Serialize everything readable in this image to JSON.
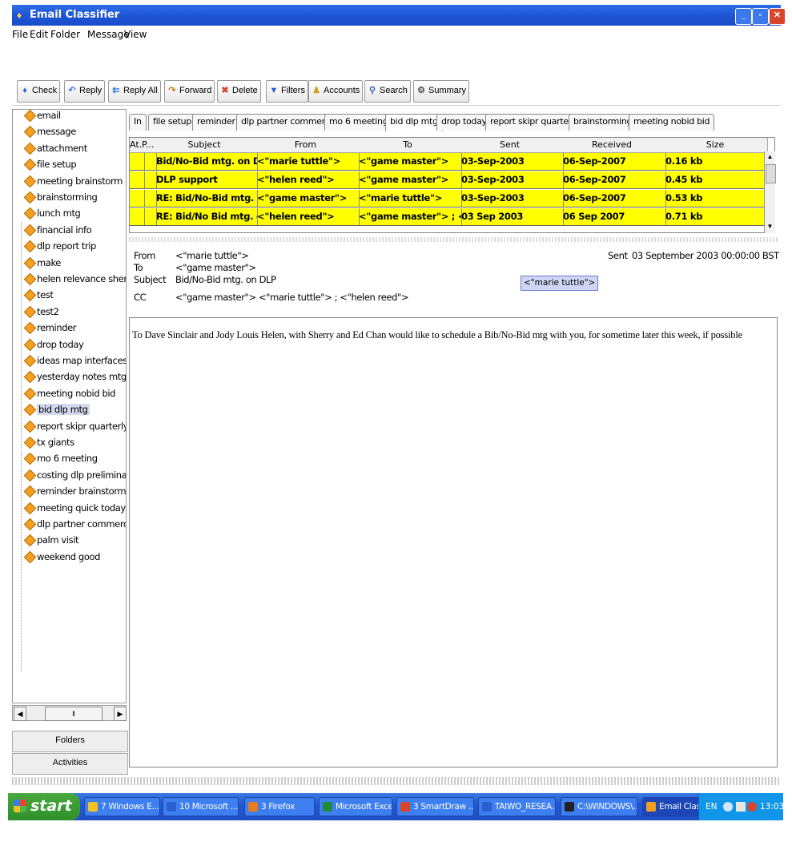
{
  "window": {
    "title": "Email Classifier"
  },
  "menu": [
    "File",
    "Edit",
    "Folder",
    "Message",
    "View"
  ],
  "toolbar": [
    {
      "label": "Check",
      "icon": "check-mail-icon",
      "color": "#2a6dd8"
    },
    {
      "label": "Reply",
      "icon": "reply-icon",
      "color": "#3a7ae8"
    },
    {
      "label": "Reply All",
      "icon": "reply-all-icon",
      "color": "#3a7ae8"
    },
    {
      "label": "Forward",
      "icon": "forward-icon",
      "color": "#d07a18"
    },
    {
      "label": "Delete",
      "icon": "delete-icon",
      "color": "#d8452b"
    },
    {
      "label": "Filters",
      "icon": "filter-icon",
      "color": "#2a5fd0"
    },
    {
      "label": "Accounts",
      "icon": "accounts-icon",
      "color": "#d0a020"
    },
    {
      "label": "Search",
      "icon": "search-icon",
      "color": "#2a5fd0"
    },
    {
      "label": "Summary",
      "icon": "summary-icon",
      "color": "#555555"
    }
  ],
  "folders": {
    "items": [
      "email",
      "message",
      "attachment",
      "file setup",
      "meeting brainstorm",
      "brainstorming",
      "lunch mtg",
      "financial info",
      "dlp report trip",
      "make",
      "helen relevance sherry",
      "test",
      "test2",
      "reminder",
      "drop today",
      "ideas map interfaces",
      "yesterday notes mtg",
      "meeting nobid bid",
      "bid dlp mtg",
      "report skipr quarterly",
      "tx giants",
      "mo 6 meeting",
      "costing dlp preliminary",
      "reminder brainstorming r",
      "meeting quick today",
      "dlp partner commercial",
      "palm visit",
      "weekend good"
    ],
    "selected": "bid dlp mtg",
    "bottom_tabs": [
      "Folders",
      "Activities"
    ]
  },
  "tabs": {
    "items": [
      "In",
      "file setup",
      "reminder",
      "dlp partner commercial",
      "mo 6 meeting",
      "bid dlp mtg",
      "drop today",
      "report skipr quarterly",
      "brainstorming",
      "meeting nobid bid"
    ],
    "active": "bid dlp mtg"
  },
  "table": {
    "columns": [
      "At..",
      "P...",
      "Subject",
      "From",
      "To",
      "Sent",
      "Received",
      "Size"
    ],
    "rows": [
      [
        "",
        "",
        "Bid/No-Bid mtg. on DLP",
        "<\"marie tuttle\">",
        "<\"game master\">",
        "03-Sep-2003",
        "06-Sep-2007",
        "0.16 kb"
      ],
      [
        "",
        "",
        "DLP support",
        "<\"helen reed\">",
        "<\"game master\">",
        "03-Sep-2003",
        "06-Sep-2007",
        "0.45 kb"
      ],
      [
        "",
        "",
        "RE: Bid/No-Bid mtg. on D...",
        "<\"game master\">",
        "<\"marie tuttle\">",
        "03-Sep-2003",
        "06-Sep-2007",
        "0.53 kb"
      ],
      [
        "",
        "",
        "RE: Bid/No Bid mtg. on D...",
        "<\"helen reed\">",
        "<\"game master\"> ; <\"ma...",
        "03 Sep 2003",
        "06 Sep 2007",
        "0.71 kb"
      ]
    ],
    "row_color": "#ffff00"
  },
  "message": {
    "from_label": "From",
    "from": "<\"marie tuttle\">",
    "to_label": "To",
    "to": "<\"game master\">",
    "subject_label": "Subject",
    "subject": "Bid/No-Bid mtg. on DLP",
    "cc_label": "CC",
    "cc": "<\"game master\"> <\"marie tuttle\"> ; <\"helen reed\">",
    "sent_label": "Sent",
    "sent": "03 September 2003 00:00:00 BST",
    "chip": "<\"marie tuttle\">",
    "body": "To Dave Sinclair and Jody Louis Helen, with Sherry and Ed Chan would like to schedule a Bib/No-Bid mtg with you, for sometime later this week, if possible"
  },
  "taskbar": {
    "start": "start",
    "items": [
      {
        "label": "7 Windows E...",
        "color": "#f3c121"
      },
      {
        "label": "10 Microsoft ...",
        "color": "#2a5fd0"
      },
      {
        "label": "3 Firefox",
        "color": "#e87a20"
      },
      {
        "label": "Microsoft Excel...",
        "color": "#1f8a3a"
      },
      {
        "label": "3 SmartDraw ...",
        "color": "#d8452b"
      },
      {
        "label": "TAIWO_RESEA...",
        "color": "#2a5fd0"
      },
      {
        "label": "C:\\WINDOWS\\...",
        "color": "#222222"
      },
      {
        "label": "Email Classifier",
        "color": "#f2a024"
      }
    ],
    "lang": "EN",
    "clock": "13:03"
  }
}
